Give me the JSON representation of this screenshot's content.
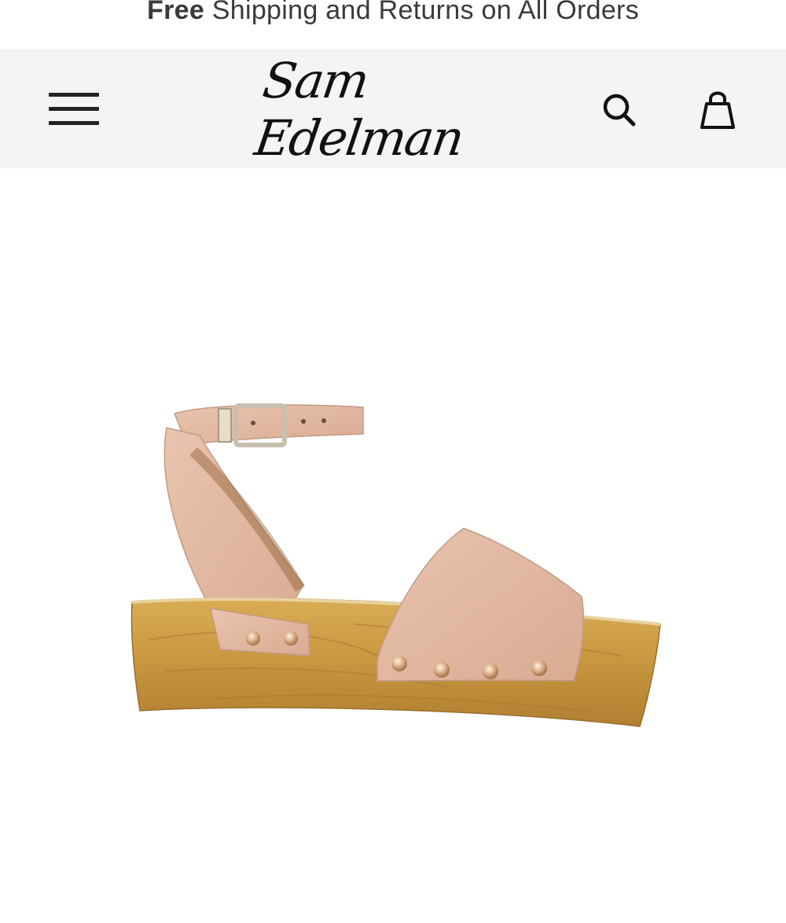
{
  "promo": {
    "bold": "Free",
    "rest": " Shipping and Returns on All Orders"
  },
  "header": {
    "logo_text": "Sam Edelman",
    "menu_icon": "hamburger-menu-icon",
    "search_icon": "search-icon",
    "bag_icon": "shopping-bag-icon"
  },
  "product": {
    "image": "blush leather ankle-strap platform sandal on wooden clog base"
  },
  "colors": {
    "promo_text": "#3a3a3a",
    "header_bg": "#f4f4f4",
    "leather": "#e2b9a3",
    "wood": "#c89a45"
  }
}
